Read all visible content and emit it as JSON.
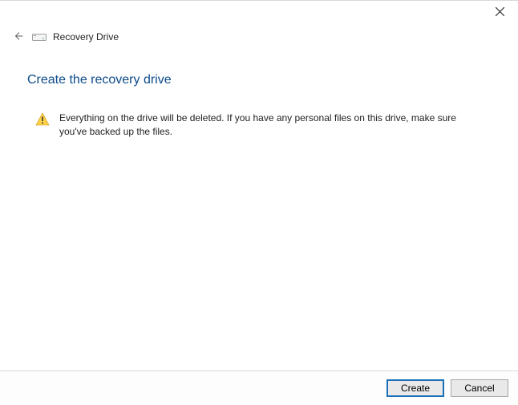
{
  "window": {
    "title": "Recovery Drive"
  },
  "page": {
    "heading": "Create the recovery drive",
    "warning_text": "Everything on the drive will be deleted. If you have any personal files on this drive, make sure you've backed up the files."
  },
  "footer": {
    "primary_label": "Create",
    "cancel_label": "Cancel"
  }
}
